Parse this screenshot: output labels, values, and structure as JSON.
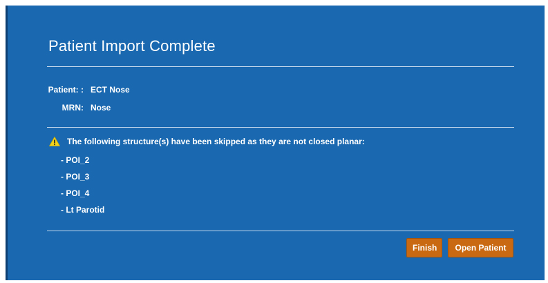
{
  "dialog": {
    "title": "Patient Import Complete",
    "patient_label": "Patient: :",
    "patient_value": "ECT Nose",
    "mrn_label": "MRN:",
    "mrn_value": "Nose",
    "warning_icon": "warning-triangle-icon",
    "warning_text": "The following structure(s) have been skipped as they are not closed planar:",
    "skipped_structures": [
      "- POI_2",
      "- POI_3",
      "- POI_4",
      "- Lt Parotid"
    ],
    "finish_label": "Finish",
    "open_patient_label": "Open Patient"
  },
  "colors": {
    "dialog_background": "#1a69b0",
    "button_background": "#c96a12",
    "warning_icon": "#f2d21b",
    "text": "#ffffff"
  }
}
